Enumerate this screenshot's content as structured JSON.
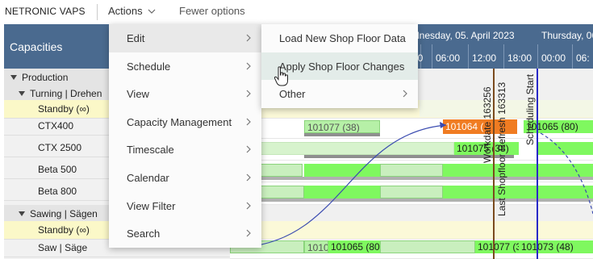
{
  "toolbar": {
    "brand": "NETRONIC VAPS",
    "actions_label": "Actions",
    "fewer_options_label": "Fewer options"
  },
  "left_panel": {
    "header": "Capacities",
    "rows": [
      {
        "label": "Production",
        "kind": "group",
        "level": 0
      },
      {
        "label": "Turning | Drehen",
        "kind": "group",
        "level": 1
      },
      {
        "label": "Standby (∞)",
        "kind": "standby",
        "level": 2
      },
      {
        "label": "CTX400",
        "kind": "resource",
        "level": 2
      },
      {
        "label": "CTX 2500",
        "kind": "resource",
        "level": 2
      },
      {
        "label": "Beta 500",
        "kind": "resource",
        "level": 2
      },
      {
        "label": "Beta 800",
        "kind": "resource",
        "level": 2
      },
      {
        "label": "Sawing | Sägen",
        "kind": "group",
        "level": 1
      },
      {
        "label": "Standby (∞)",
        "kind": "standby",
        "level": 2
      },
      {
        "label": "Saw | Säge",
        "kind": "resource",
        "level": 2
      }
    ]
  },
  "gantt": {
    "day1": "dnesday, 05. April 2023",
    "day2": "Thursday, 06",
    "times": [
      "00",
      "06:00",
      "12:00",
      "18:00",
      "00:00",
      "06:"
    ],
    "bars": {
      "ctx400_a": "101077 (38)",
      "ctx400_b": "101064 (",
      "ctx400_c": "101065 (80)",
      "ctx2500_a": "60)",
      "ctx2500_b": "101075 (38)",
      "saw_a": "1010",
      "saw_b": "101065 (80)",
      "saw_c": "101077 (3",
      "saw_d": "101073 (48)"
    },
    "vlabels": {
      "workdate": "Workdate 163256",
      "last_shopfloor": "Last Shopfloor Refresh 163313",
      "scheduling_start": "Scheduling Start"
    }
  },
  "actions_menu": {
    "items": [
      {
        "label": "Edit",
        "state": "active"
      },
      {
        "label": "Schedule"
      },
      {
        "label": "View"
      },
      {
        "label": "Capacity Management"
      },
      {
        "label": "Timescale"
      },
      {
        "label": "Calendar"
      },
      {
        "label": "View Filter"
      },
      {
        "label": "Search"
      }
    ]
  },
  "edit_submenu": {
    "items": [
      {
        "label": "Load New Shop Floor Data",
        "has_submenu": false
      },
      {
        "label": "Apply Shop Floor Changes",
        "has_submenu": false,
        "state": "hover"
      },
      {
        "label": "Other",
        "has_submenu": true
      }
    ]
  },
  "colors": {
    "header_blue": "#4a6a8f",
    "bar_green": "#7ff85f",
    "bar_light_green": "#b6f0a7",
    "bar_orange": "#f07c22",
    "scheduling_line": "#2828c8",
    "workdate_line": "#7a4a1e"
  }
}
